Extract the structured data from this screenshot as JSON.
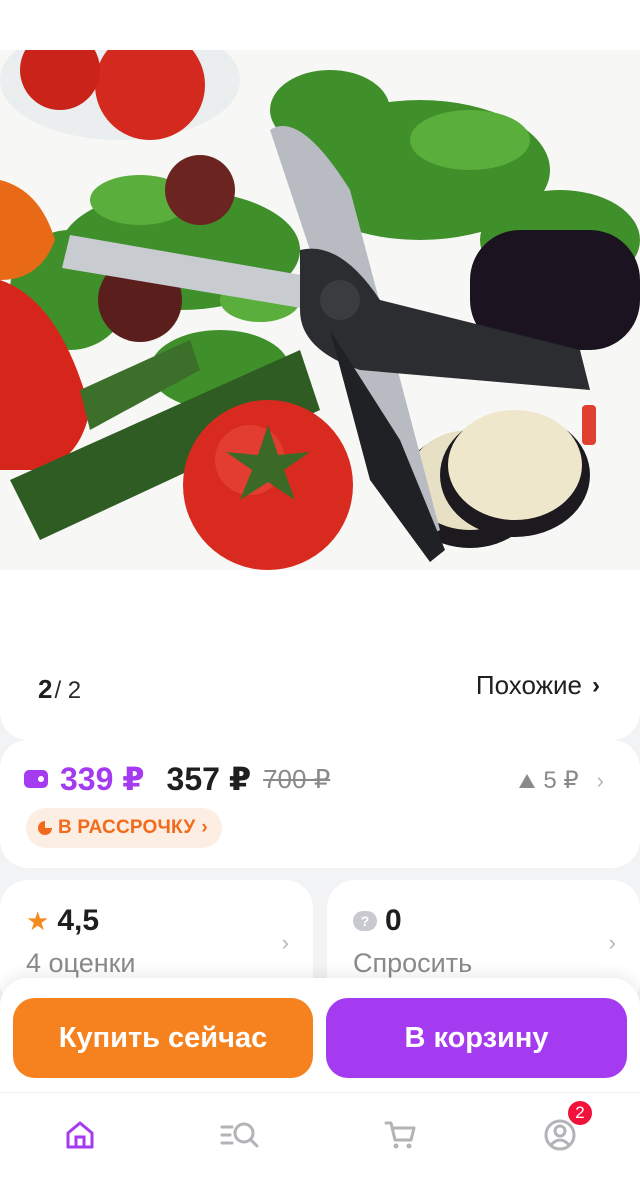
{
  "gallery": {
    "current_page": "2",
    "total_pages": "/ 2",
    "similar_label": "Похожие",
    "similar_chevron": "›"
  },
  "price": {
    "card_price": "339 ₽",
    "regular_price": "357 ₽",
    "old_price": "700 ₽",
    "price_change": "5 ₽",
    "price_change_chevron": "›",
    "installment_label": "В РАССРОЧКУ",
    "installment_chevron": "›"
  },
  "rating": {
    "value": "4,5",
    "count_label": "4 оценки",
    "chevron": "›"
  },
  "questions": {
    "count": "0",
    "label": "Спросить",
    "chevron": "›"
  },
  "actions": {
    "buy_now_label": "Купить сейчас",
    "add_to_cart_label": "В корзину"
  },
  "tabbar": {
    "profile_badge": "2"
  },
  "colors": {
    "accent_purple": "#a43bf0",
    "accent_orange": "#f5821f",
    "badge_red": "#f2123c"
  },
  "icons": [
    "wallet-icon",
    "pie-chart-icon",
    "star-icon",
    "question-icon",
    "home-icon",
    "catalog-search-icon",
    "cart-icon",
    "profile-icon",
    "triangle-up-icon"
  ]
}
